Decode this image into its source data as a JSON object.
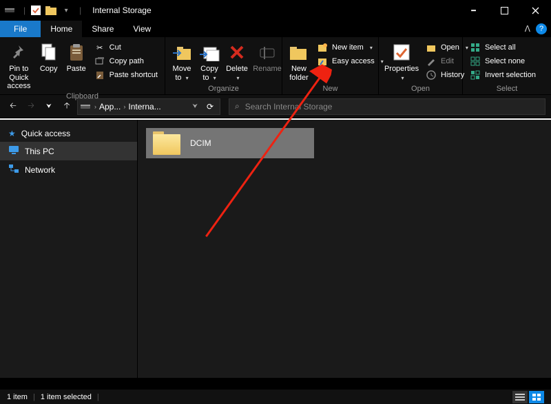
{
  "titlebar": {
    "title": "Internal Storage"
  },
  "tabs": {
    "file": "File",
    "home": "Home",
    "share": "Share",
    "view": "View"
  },
  "ribbon": {
    "clipboard": {
      "label": "Clipboard",
      "pin": "Pin to Quick access",
      "copy": "Copy",
      "paste": "Paste",
      "cut": "Cut",
      "copy_path": "Copy path",
      "paste_shortcut": "Paste shortcut"
    },
    "organize": {
      "label": "Organize",
      "move_to": "Move to",
      "copy_to": "Copy to",
      "delete": "Delete",
      "rename": "Rename"
    },
    "new": {
      "label": "New",
      "new_folder": "New folder",
      "new_item": "New item",
      "easy_access": "Easy access"
    },
    "open": {
      "label": "Open",
      "properties": "Properties",
      "open": "Open",
      "edit": "Edit",
      "history": "History"
    },
    "select": {
      "label": "Select",
      "select_all": "Select all",
      "select_none": "Select none",
      "invert": "Invert selection"
    }
  },
  "address": {
    "seg1": "App...",
    "seg2": "Interna..."
  },
  "search": {
    "placeholder": "Search Internal Storage"
  },
  "sidebar": {
    "quick_access": "Quick access",
    "this_pc": "This PC",
    "network": "Network"
  },
  "content": {
    "items": [
      {
        "name": "DCIM"
      }
    ]
  },
  "status": {
    "count": "1 item",
    "selected": "1 item selected"
  }
}
